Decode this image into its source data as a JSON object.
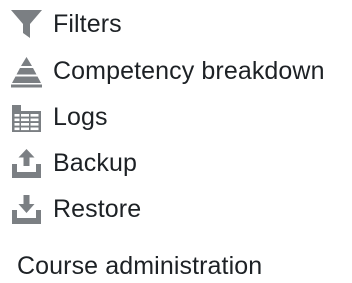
{
  "menu": {
    "items": [
      {
        "label": "Filters",
        "icon": "funnel-icon"
      },
      {
        "label": "Competency breakdown",
        "icon": "triangle-levels-icon"
      },
      {
        "label": "Logs",
        "icon": "log-table-icon"
      },
      {
        "label": "Backup",
        "icon": "upload-tray-icon"
      },
      {
        "label": "Restore",
        "icon": "download-tray-icon"
      }
    ]
  },
  "course_admin": {
    "label": "Course administration"
  },
  "colors": {
    "icon": "#7b7f83",
    "text": "#1d2125",
    "background": "#ffffff"
  }
}
